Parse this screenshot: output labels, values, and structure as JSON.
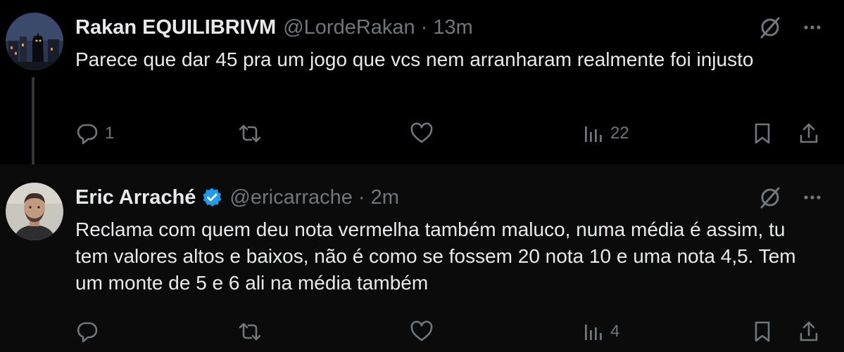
{
  "tweets": [
    {
      "author_name": "Rakan EQUILIBRIVM",
      "handle": "@LordeRakan",
      "separator": "·",
      "time": "13m",
      "text": "Parece que dar 45 pra um jogo que vcs nem arranharam realmente foi injusto",
      "replies": "1",
      "retweets": "",
      "likes": "",
      "views": "22",
      "verified": false
    },
    {
      "author_name": "Eric Arraché",
      "handle": "@ericarrache",
      "separator": "·",
      "time": "2m",
      "text": "Reclama com quem deu nota vermelha também maluco, numa média é assim, tu tem valores altos e baixos, não é como se fossem 20 nota 10 e uma nota 4,5. Tem um monte de 5 e 6 ali na média também",
      "replies": "",
      "retweets": "",
      "likes": "",
      "views": "4",
      "verified": true
    }
  ],
  "icons": {
    "reply": "reply-icon",
    "retweet": "retweet-icon",
    "like": "heart-icon",
    "views": "views-icon",
    "bookmark": "bookmark-icon",
    "share": "share-icon",
    "grok": "grok-icon",
    "more": "more-icon",
    "verified": "verified-badge-icon"
  },
  "colors": {
    "background": "#000000",
    "text": "#e7e9ea",
    "muted": "#71767b",
    "verified": "#1d9bf0"
  }
}
